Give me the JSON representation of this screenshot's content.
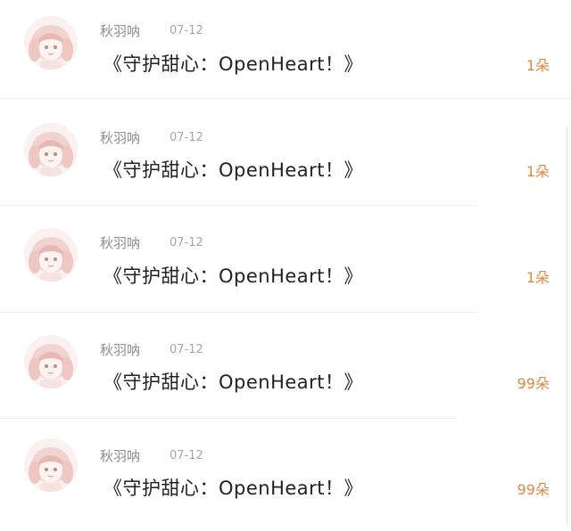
{
  "feed": {
    "items": [
      {
        "author": "秋羽呐",
        "date": "07-12",
        "title": "《守护甜心：OpenHeart！》",
        "count": "1朵",
        "avatar_icon": "anime-girl-avatar-icon"
      },
      {
        "author": "秋羽呐",
        "date": "07-12",
        "title": "《守护甜心：OpenHeart！》",
        "count": "1朵",
        "avatar_icon": "anime-girl-avatar-icon"
      },
      {
        "author": "秋羽呐",
        "date": "07-12",
        "title": "《守护甜心：OpenHeart！》",
        "count": "1朵",
        "avatar_icon": "anime-girl-avatar-icon"
      },
      {
        "author": "秋羽呐",
        "date": "07-12",
        "title": "《守护甜心：OpenHeart！》",
        "count": "99朵",
        "avatar_icon": "anime-girl-avatar-icon"
      },
      {
        "author": "秋羽呐",
        "date": "07-12",
        "title": "《守护甜心：OpenHeart！》",
        "count": "99朵",
        "avatar_icon": "anime-girl-avatar-icon"
      }
    ]
  },
  "colors": {
    "count_accent": "#e2883e",
    "author_text": "#8f8f8f",
    "title_text": "#222222"
  }
}
